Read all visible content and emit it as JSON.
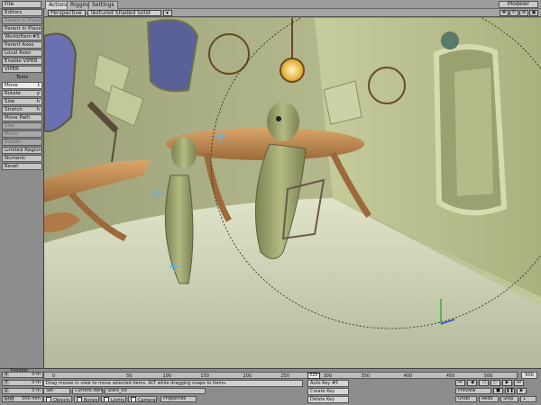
{
  "menu": {
    "file": "File",
    "modeler": "Modeler"
  },
  "tabs": [
    {
      "label": "Actions",
      "active": true
    },
    {
      "label": "Rigging",
      "active": false
    },
    {
      "label": "Settings",
      "active": false
    }
  ],
  "viewport_bar": {
    "view": "Perspective",
    "shading": "Textured Shaded Solid"
  },
  "sidebar": {
    "editors": "Editors",
    "buttons": [
      {
        "label": "Parent in Place",
        "dim": true
      },
      {
        "label": "Parent in Place",
        "dim": false
      },
      {
        "label": "World/Item",
        "kbd": "#5",
        "dim": false
      },
      {
        "label": "Parent Axes",
        "dim": false
      },
      {
        "label": "Local Axes",
        "dim": false
      },
      {
        "label": "Enable VIPER",
        "dim": false
      },
      {
        "label": "VIPER",
        "dim": false
      }
    ],
    "tools_header": "Tools",
    "tools": [
      {
        "label": "Move",
        "kbd": "t",
        "active": true
      },
      {
        "label": "Rotate",
        "kbd": "y"
      },
      {
        "label": "Size",
        "kbd": "h"
      },
      {
        "label": "Stretch",
        "kbd": "h"
      },
      {
        "label": "Move Path",
        "kbd": ""
      },
      {
        "label": "Size",
        "kbd": "",
        "dim": true
      },
      {
        "label": "Move",
        "kbd": "",
        "dim": true
      },
      {
        "label": "Rotate",
        "kbd": "",
        "dim": true
      },
      {
        "label": "Limited Region",
        "kbd": ""
      },
      {
        "label": "Numeric",
        "kbd": ""
      },
      {
        "label": "Reset",
        "kbd": ""
      }
    ]
  },
  "timeline": {
    "ticks": [
      "0",
      "50",
      "100",
      "150",
      "200",
      "250",
      "300",
      "350",
      "400",
      "450",
      "500"
    ],
    "current": "320",
    "end": "500"
  },
  "position": {
    "label": "Position",
    "x": {
      "axis": "X",
      "value": "0 m"
    },
    "y": {
      "axis": "Y",
      "value": "0 m"
    },
    "z": {
      "axis": "Z",
      "value": "0 m"
    },
    "grid_label": "Grid",
    "grid_value": "500 mm"
  },
  "status_text": "Drag mouse in view to move selected items. ALT while dragging snaps to items.",
  "controls": {
    "current_item_label": "Current Item",
    "current_item_value": "Stars_09",
    "set": "Set",
    "objects": "Objects",
    "bones": "Bones",
    "lights": "Lights",
    "cameras": "Cameras",
    "properties": "Properties"
  },
  "keys": {
    "auto_key": "Auto Key",
    "auto_key_kbd": "#5",
    "create_key": "Create Key",
    "delete_key": "Delete Key"
  },
  "playback": {
    "preview": "Preview",
    "undo": "Undo",
    "redo": "Redo",
    "step": "Step",
    "step_value": "1"
  },
  "colors": {
    "wall": "#b8bf8e",
    "floor": "#d8dcc4",
    "table_wood": "#c9945a",
    "character_skin": "#9aa06a"
  }
}
